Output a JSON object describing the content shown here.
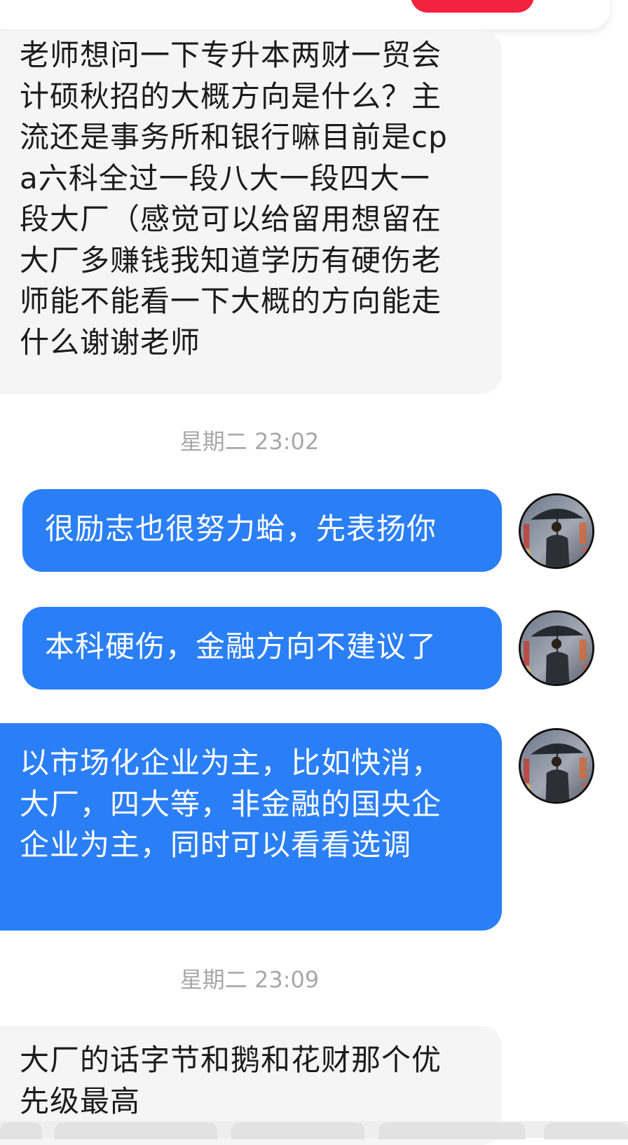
{
  "messages": [
    {
      "id": "m1",
      "direction": "incoming",
      "text": "老师想问一下专升本两财一贸会计硕秋招的大概方向是什么？主流还是事务所和银行嘛目前是cpa六科全过一段八大一段四大一段大厂（感觉可以给留用想留在大厂多赚钱我知道学历有硬伤老师能不能看一下大概的方向能走什么谢谢老师"
    },
    {
      "id": "ts1",
      "type": "timestamp",
      "text": "星期二 23:02"
    },
    {
      "id": "m2",
      "direction": "outgoing",
      "text": "很励志也很努力蛤，先表扬你"
    },
    {
      "id": "m3",
      "direction": "outgoing",
      "text": "本科硬伤，金融方向不建议了"
    },
    {
      "id": "m4",
      "direction": "outgoing",
      "text": "以市场化企业为主，比如快消，大厂，四大等，非金融的国央企企业为主，同时可以看看选调"
    },
    {
      "id": "ts2",
      "type": "timestamp",
      "text": "星期二 23:09"
    },
    {
      "id": "m5",
      "direction": "incoming",
      "text": "大厂的话字节和鹅和花财那个优先级最高"
    }
  ],
  "avatar_icon": "man-with-umbrella-avatar",
  "colors": {
    "outgoing_bubble": "#2b7ff6",
    "incoming_bubble": "#f5f5f5",
    "accent_red": "#f4213f",
    "timestamp_text": "#a8a8a8"
  }
}
